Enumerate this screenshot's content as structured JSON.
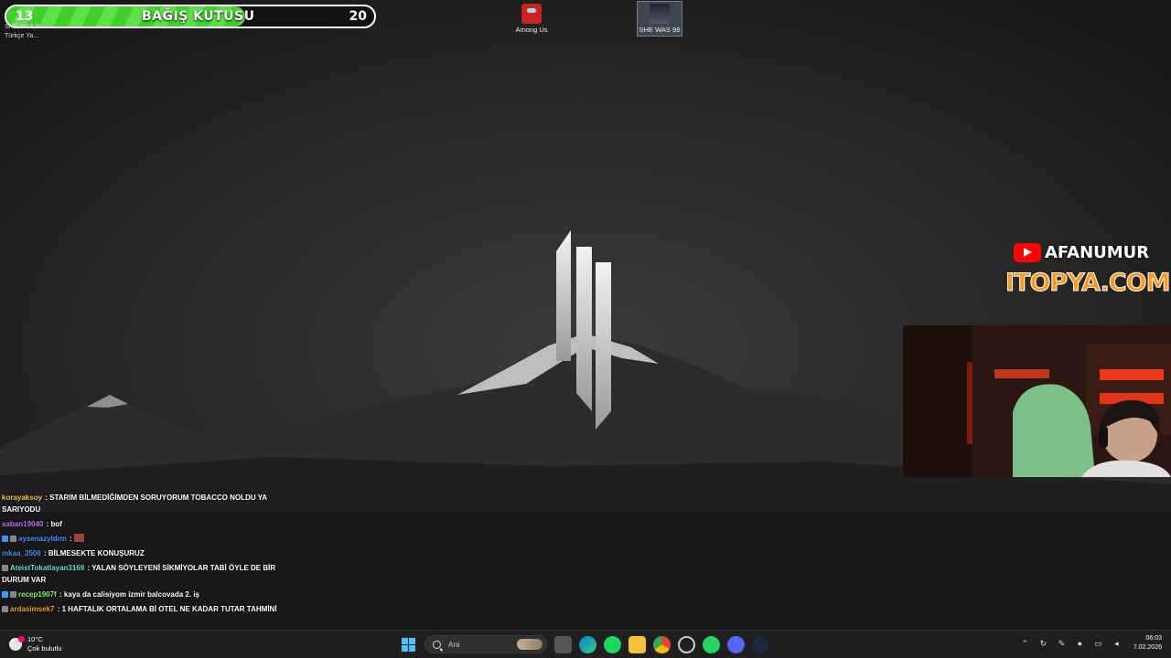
{
  "donation": {
    "current": "13",
    "target": "20",
    "title": "BAĞIŞ KUTUSU",
    "progress": 0.65,
    "colors": {
      "fill": "#3fd12a",
      "border": "#ffffff"
    }
  },
  "desktop_partial_labels": [
    "SHE WAS 9",
    "Türkçe Ya..."
  ],
  "desktop_icons": [
    {
      "label": "Among Us",
      "icon": "among-us-icon"
    },
    {
      "label": "SHE WAS 98",
      "icon": "she-was-98-icon"
    }
  ],
  "overlay": {
    "channel": "AFANUMUR",
    "sponsor": "ITOPYA.COM"
  },
  "chat": [
    {
      "user": "korayaksoy",
      "color": "#f0c850",
      "badges": [],
      "text": "STARIM BİLMEDİĞİMDEN SORUYORUM TOBACCO NOLDU YA SARIYODU"
    },
    {
      "user": "saban19040",
      "color": "#c070f0",
      "badges": [],
      "text": "bof"
    },
    {
      "user": "aysenazyldrm",
      "color": "#4a8cff",
      "badges": [
        "#4a8cff",
        "#888888"
      ],
      "text": ""
    },
    {
      "user": "mkaa_3506",
      "color": "#4a90e0",
      "badges": [],
      "text": "BİLMESEKTE KONUŞURUZ"
    },
    {
      "user": "AteistTokatlayan3169",
      "color": "#6fd8d0",
      "badges": [
        "#888888"
      ],
      "text": "YALAN SÖYLEYENİ SİKMİYOLAR TABİ ÖYLE DE BİR DURUM VAR"
    },
    {
      "user": "recep1907f",
      "color": "#8ef05a",
      "badges": [
        "#3aa0ff",
        "#888888"
      ],
      "text": "kaya da calisiyom izmir balcovada 2. iş"
    },
    {
      "user": "ardasimsek7",
      "color": "#f0a030",
      "badges": [
        "#888888"
      ],
      "text": "1 HAFTALIK ORTALAMA Bİ OTEL NE KADAR TUTAR TAHMİNİ"
    }
  ],
  "taskbar": {
    "weather_temp": "10°C",
    "weather_desc": "Çok bulutlu",
    "search_placeholder": "Ara",
    "time": "06:03",
    "date": "7.02.2026"
  }
}
